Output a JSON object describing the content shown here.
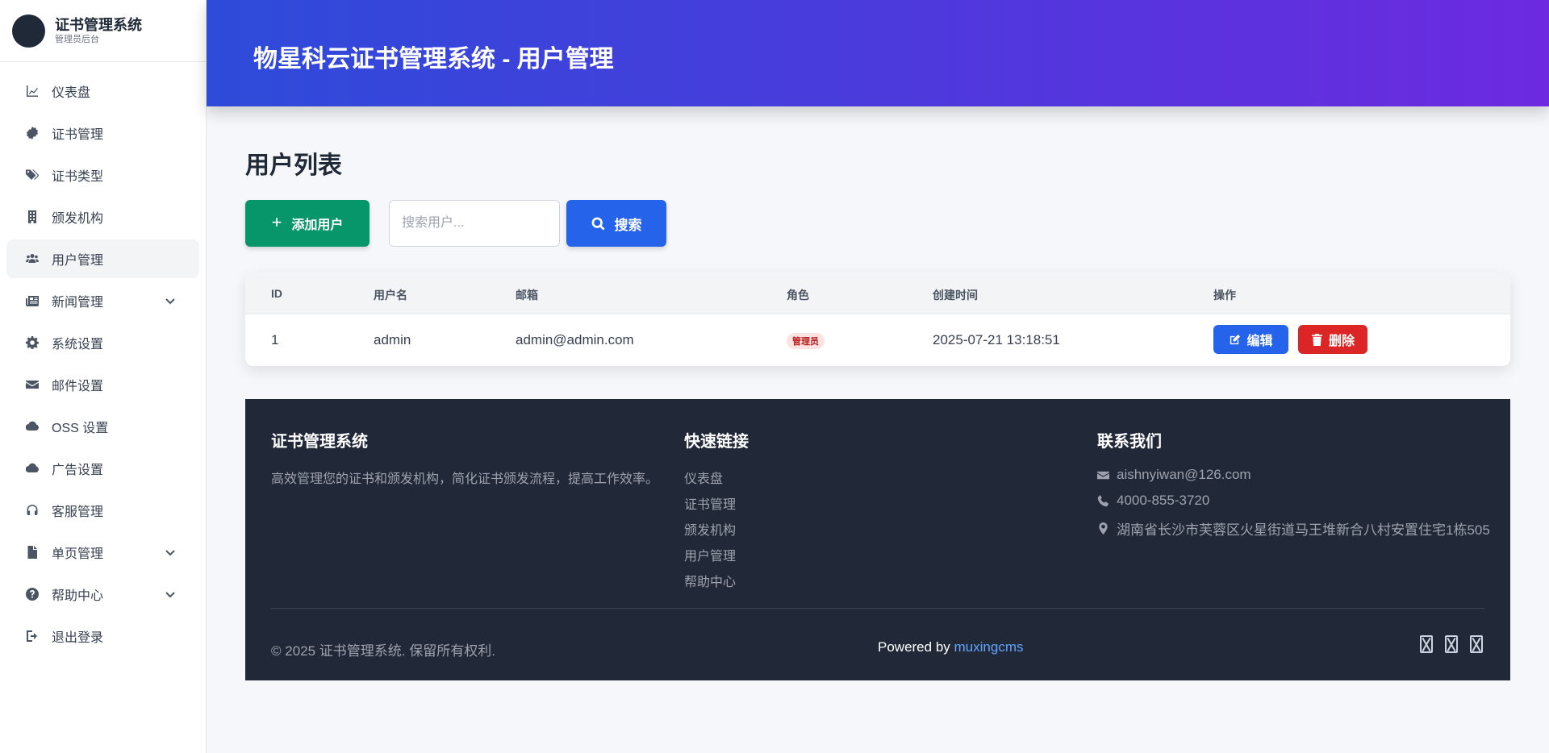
{
  "brand": {
    "title": "证书管理系统",
    "subtitle": "管理员后台"
  },
  "sidebar": {
    "items": [
      {
        "label": "仪表盘",
        "icon": "chart-line-icon",
        "active": false,
        "has_submenu": false
      },
      {
        "label": "证书管理",
        "icon": "certificate-icon",
        "active": false,
        "has_submenu": false
      },
      {
        "label": "证书类型",
        "icon": "tags-icon",
        "active": false,
        "has_submenu": false
      },
      {
        "label": "颁发机构",
        "icon": "building-icon",
        "active": false,
        "has_submenu": false
      },
      {
        "label": "用户管理",
        "icon": "users-icon",
        "active": true,
        "has_submenu": false
      },
      {
        "label": "新闻管理",
        "icon": "newspaper-icon",
        "active": false,
        "has_submenu": true
      },
      {
        "label": "系统设置",
        "icon": "gear-icon",
        "active": false,
        "has_submenu": false
      },
      {
        "label": "邮件设置",
        "icon": "envelope-icon",
        "active": false,
        "has_submenu": false
      },
      {
        "label": "OSS 设置",
        "icon": "cloud-icon",
        "active": false,
        "has_submenu": false
      },
      {
        "label": "广告设置",
        "icon": "cloud-icon",
        "active": false,
        "has_submenu": false
      },
      {
        "label": "客服管理",
        "icon": "headset-icon",
        "active": false,
        "has_submenu": false
      },
      {
        "label": "单页管理",
        "icon": "file-icon",
        "active": false,
        "has_submenu": true
      },
      {
        "label": "帮助中心",
        "icon": "question-circle-icon",
        "active": false,
        "has_submenu": true
      },
      {
        "label": "退出登录",
        "icon": "sign-out-icon",
        "active": false,
        "has_submenu": false
      }
    ]
  },
  "header": {
    "title": "物星科云证书管理系统 - 用户管理"
  },
  "main": {
    "page_title": "用户列表",
    "add_button": "添加用户",
    "search": {
      "placeholder": "搜索用户...",
      "value": "",
      "button_label": "搜索"
    },
    "table": {
      "columns": [
        "ID",
        "用户名",
        "邮箱",
        "角色",
        "创建时间",
        "操作"
      ],
      "rows": [
        {
          "id": "1",
          "username": "admin",
          "email": "admin@admin.com",
          "role": "管理员",
          "created": "2025-07-21 13:18:51",
          "edit_label": "编辑",
          "delete_label": "删除"
        }
      ]
    }
  },
  "footer": {
    "about": {
      "title": "证书管理系统",
      "description": "高效管理您的证书和颁发机构，简化证书颁发流程，提高工作效率。"
    },
    "links": {
      "title": "快速链接",
      "items": [
        "仪表盘",
        "证书管理",
        "颁发机构",
        "用户管理",
        "帮助中心"
      ]
    },
    "contact": {
      "title": "联系我们",
      "email": "aishnyiwan@126.com",
      "phone": "4000-855-3720",
      "address": "湖南省长沙市芙蓉区火星街道马王堆新合八村安置住宅1栋505"
    },
    "copyright": "© 2025 证书管理系统. 保留所有权利.",
    "powered_prefix": "Powered by",
    "powered_link": "muxingcms",
    "social_icons": [
      "missing-glyph-icon",
      "missing-glyph-icon",
      "missing-glyph-icon"
    ]
  },
  "colors": {
    "accent": "#2563eb",
    "success": "#079669",
    "danger": "#dc2626",
    "footer_bg": "#212837"
  }
}
